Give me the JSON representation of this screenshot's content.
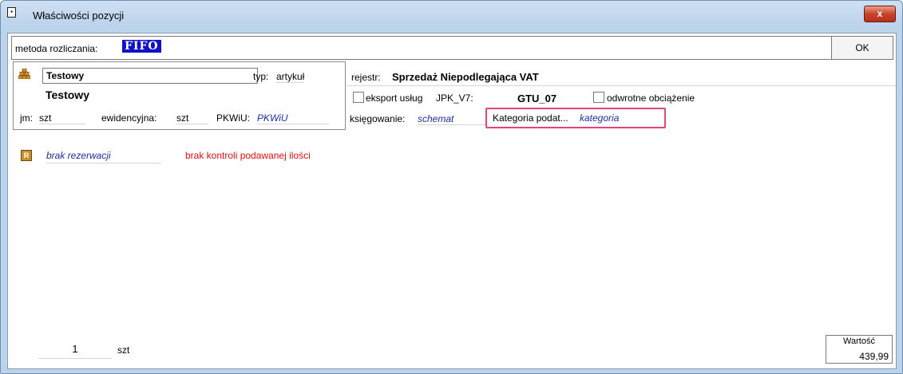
{
  "window": {
    "title": "Właściwości pozycji",
    "close_label": "x"
  },
  "header": {
    "metoda_label": "metoda rozliczania:",
    "metoda_value": "FIFO",
    "ok_label": "OK"
  },
  "article": {
    "name_field": "Testowy",
    "typ_label": "typ:",
    "typ_value": "artykuł",
    "title": "Testowy",
    "jm_label": "jm:",
    "jm_value": "szt",
    "ewidencyjna_label": "ewidencyjna:",
    "ewidencyjna_value": "szt",
    "pkwiu_label": "PKWiU:",
    "pkwiu_value": "PKWiU"
  },
  "register": {
    "rejestr_label": "rejestr:",
    "rejestr_value": "Sprzedaż Niepodlegająca VAT",
    "eksport_label": "eksport usług",
    "jpk_label": "JPK_V7:",
    "gtu_value": "GTU_07",
    "odwrotne_label": "odwrotne obciążenie",
    "ksiegowanie_label": "księgowanie:",
    "ksiegowanie_value": "schemat",
    "kategoria_label": "Kategoria podat...",
    "kategoria_value": "kategoria"
  },
  "reservation": {
    "value": "brak rezerwacji",
    "warning": "brak kontroli podawanej ilości"
  },
  "footer": {
    "quantity": "1",
    "unit": "szt",
    "wartosc_label": "Wartość",
    "wartosc_value": "439,99"
  },
  "colors": {
    "fifo_bg": "#1010c8",
    "highlight_border": "#e0457b",
    "warning_text": "#e01010",
    "italic_value": "#1f2f9e"
  }
}
